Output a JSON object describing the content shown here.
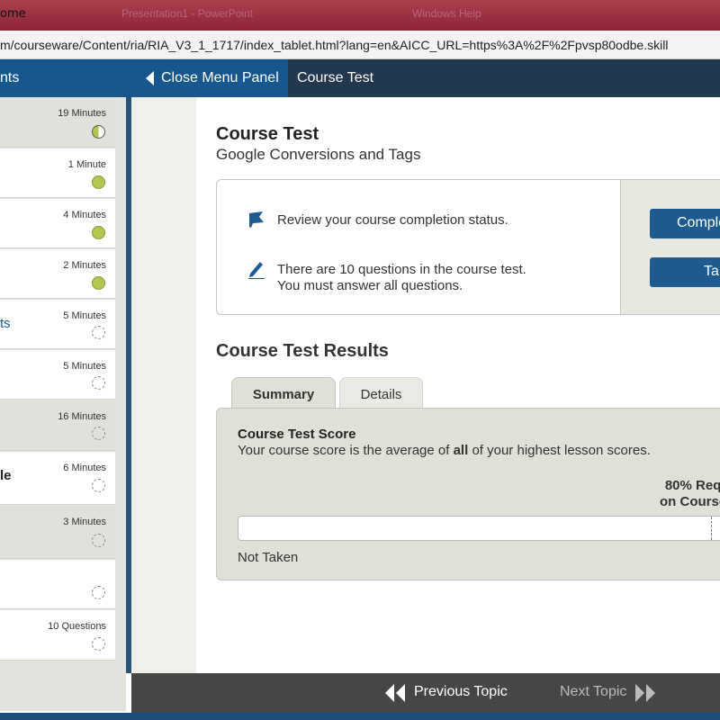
{
  "window": {
    "title": "ome",
    "ghost_text_1": "Presentation1 - PowerPoint",
    "ghost_text_2": "Windows Help"
  },
  "browser": {
    "url": "m/courseware/Content/ria/RIA_V3_1_1717/index_tablet.html?lang=en&AICC_URL=https%3A%2F%2Fpvsp80odbe.skill"
  },
  "header": {
    "left_tab": "nts",
    "close_menu": "Close Menu Panel",
    "breadcrumb": "Course Test"
  },
  "sidebar": {
    "items": [
      {
        "name": "",
        "duration": "19 Minutes",
        "status": "half"
      },
      {
        "name": "",
        "duration": "1 Minute",
        "status": "done"
      },
      {
        "name": "",
        "duration": "4 Minutes",
        "status": "done"
      },
      {
        "name": "",
        "duration": "2 Minutes",
        "status": "done"
      },
      {
        "name": "ts",
        "duration": "5 Minutes",
        "status": "open"
      },
      {
        "name": "",
        "duration": "5 Minutes",
        "status": "open"
      },
      {
        "name": "",
        "duration": "16 Minutes",
        "status": "open"
      },
      {
        "name": "le",
        "duration": "6 Minutes",
        "status": "open"
      },
      {
        "name": "",
        "duration": "3 Minutes",
        "status": "open"
      },
      {
        "name": "",
        "duration": "",
        "status": "open"
      },
      {
        "name": "",
        "duration": "10 Questions",
        "status": "open"
      }
    ]
  },
  "main": {
    "title": "Course Test",
    "subtitle": "Google Conversions and Tags",
    "info": {
      "review_text": "Review your course completion status.",
      "questions_line1": "There are 10 questions in the course test.",
      "questions_line2": "You must answer all questions.",
      "completion_button": "Comple",
      "take_button": "Ta"
    },
    "results_title": "Course Test Results",
    "tabs": [
      "Summary",
      "Details"
    ],
    "score": {
      "title": "Course Test Score",
      "desc_before": "Your course score is the average of ",
      "desc_bold": "all",
      "desc_after": " of your highest lesson scores.",
      "required_line1": "80% Req",
      "required_line2": "on Course",
      "status": "Not Taken",
      "score_value": 0
    }
  },
  "footer": {
    "previous": "Previous Topic",
    "next": "Next Topic"
  },
  "colors": {
    "primary_blue": "#1d5b90",
    "nav_dark": "#22384f",
    "complete_green": "#b4c54f",
    "footer_bg": "#474644"
  }
}
